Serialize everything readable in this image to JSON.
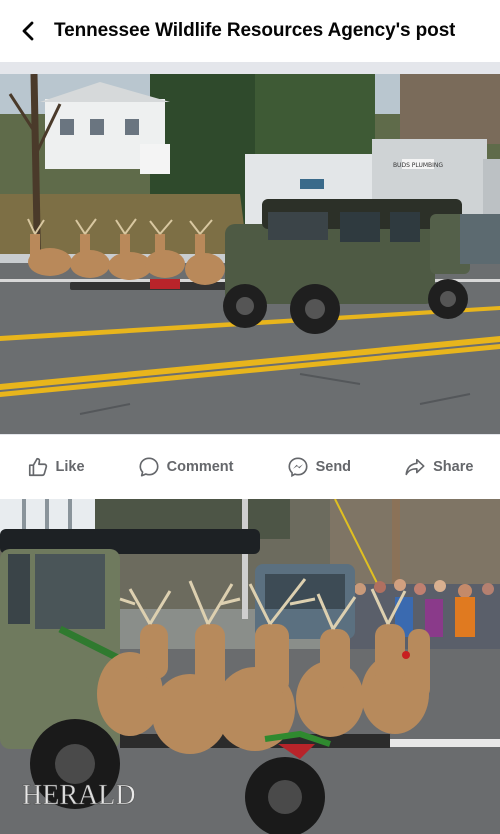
{
  "header": {
    "title": "Tennessee Wildlife Resources Agency's post",
    "back_icon": "chevron-left-icon"
  },
  "photo1": {
    "building_sign": "BUDS PLUMBING"
  },
  "actions": [
    {
      "label": "Like",
      "icon": "thumbs-up-icon"
    },
    {
      "label": "Comment",
      "icon": "comment-bubble-icon"
    },
    {
      "label": "Send",
      "icon": "messenger-icon"
    },
    {
      "label": "Share",
      "icon": "share-arrow-icon"
    }
  ],
  "photo2": {
    "watermark": "HERALD"
  },
  "colors": {
    "action_gray": "#65676b",
    "separator": "#e4e6eb",
    "road_yellow": "#e8b51c"
  }
}
